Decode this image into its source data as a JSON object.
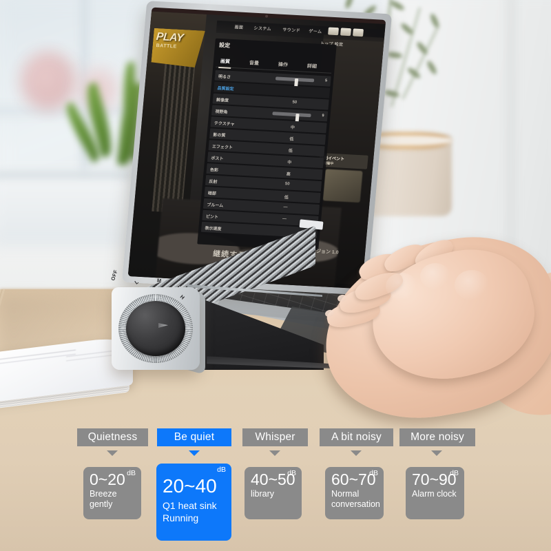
{
  "scene": {
    "description": "Product photo: laptop on a silver cooling stand with fan dial, hands typing, wooden desk",
    "desk_color": "#e2cdb0",
    "device_labels": {
      "dial_positions": [
        "OFF",
        "L",
        "M",
        "H"
      ]
    },
    "laptop_screen": {
      "game_logo": "PLAY",
      "game_logo_sub": "BATTLE",
      "panel_title": "設定",
      "panel_tabs": [
        "画質",
        "音量",
        "操作",
        "詳細"
      ],
      "top_bar": [
        "画面",
        "システム",
        "サウンド",
        "ゲーム"
      ],
      "top_bar_sub": "トップ 設定",
      "panel_rows": [
        {
          "label": "明るさ",
          "value": "",
          "slider": 52,
          "num": "5"
        },
        {
          "label": "品質設定",
          "value": "",
          "header": true
        },
        {
          "label": "解像度",
          "value": "50"
        },
        {
          "label": "視野角",
          "value": "",
          "slider": 62,
          "num": "9"
        },
        {
          "label": "テクスチャ",
          "value": "中"
        },
        {
          "label": "影の質",
          "value": "低"
        },
        {
          "label": "エフェクト",
          "value": "低"
        },
        {
          "label": "ポスト",
          "value": "中"
        },
        {
          "label": "色彩",
          "value": "高"
        },
        {
          "label": "反射",
          "value": "50"
        },
        {
          "label": "暗部",
          "value": "低"
        },
        {
          "label": "ブルーム",
          "value": "—"
        },
        {
          "label": "ピント",
          "value": "—"
        },
        {
          "label": "表示速度",
          "value": ""
        }
      ],
      "panel_button": "適用",
      "bottom_text": "継続する",
      "badge_title": "特別イベント",
      "badge_sub": "開催中",
      "bottom_right": "バージョン 1.0"
    }
  },
  "noise_scale": {
    "accent_color": "#0d78fa",
    "neutral_color": "#8a8a8a",
    "unit": "dB",
    "levels": [
      {
        "chip_label": "Quietness",
        "range": "0~20",
        "description": "Breeze\ngently",
        "description_lines": [
          "Breeze",
          "gently"
        ],
        "highlighted": false
      },
      {
        "chip_label": "Be quiet",
        "range": "20~40",
        "description": "Q1 heat sink\nRunning",
        "description_lines": [
          "Q1 heat sink",
          "Running"
        ],
        "highlighted": true
      },
      {
        "chip_label": "Whisper",
        "range": "40~50",
        "description": "library",
        "description_lines": [
          "library"
        ],
        "highlighted": false
      },
      {
        "chip_label": "A bit noisy",
        "range": "60~70",
        "description": "Normal\nconversation",
        "description_lines": [
          "Normal",
          "conversation"
        ],
        "highlighted": false
      },
      {
        "chip_label": "More noisy",
        "range": "70~90",
        "description": "Alarm clock",
        "description_lines": [
          "Alarm clock"
        ],
        "highlighted": false
      }
    ]
  }
}
